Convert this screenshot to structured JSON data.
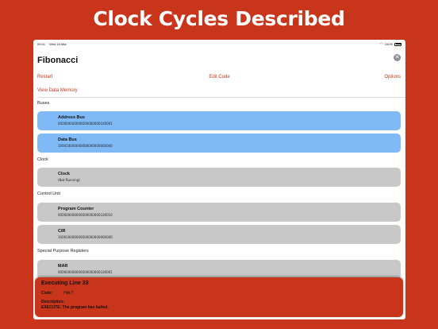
{
  "promo": {
    "title": "Clock Cycles Described"
  },
  "status_bar": {
    "time": "09:41",
    "date": "Wed 18 Mar",
    "battery": "100%"
  },
  "header": {
    "title": "Fibonacci"
  },
  "toolbar": {
    "restart": "Restart",
    "edit_code": "Edit Code",
    "options": "Options"
  },
  "view_memory": "View Data Memory",
  "sections": {
    "buses": "Buses",
    "clock": "Clock",
    "control_unit": "Control Unit",
    "special_registers": "Special Purpose Registers"
  },
  "cards": {
    "address_bus": {
      "title": "Address Bus",
      "value": "000000000000000000000100001"
    },
    "data_bus": {
      "title": "Data Bus",
      "value": "100010000000000000000000000"
    },
    "clock": {
      "title": "Clock",
      "value": "(Not Running)"
    },
    "program_counter": {
      "title": "Program Counter",
      "value": "000000000000000000000100010"
    },
    "cir": {
      "title": "CIR",
      "value": "100010000000000000000000000"
    },
    "mar": {
      "title": "MAR",
      "value": "000000000000000000000100001"
    }
  },
  "execution": {
    "title": "Executing Line 33",
    "code_label": "Code:",
    "code_value": "HALT",
    "description_label": "Description:",
    "description": "EXECUTE: The program has halted."
  },
  "colors": {
    "accent": "#c9351a",
    "bus_blue": "#7fbaf7",
    "register_grey": "#c8c8c8"
  }
}
